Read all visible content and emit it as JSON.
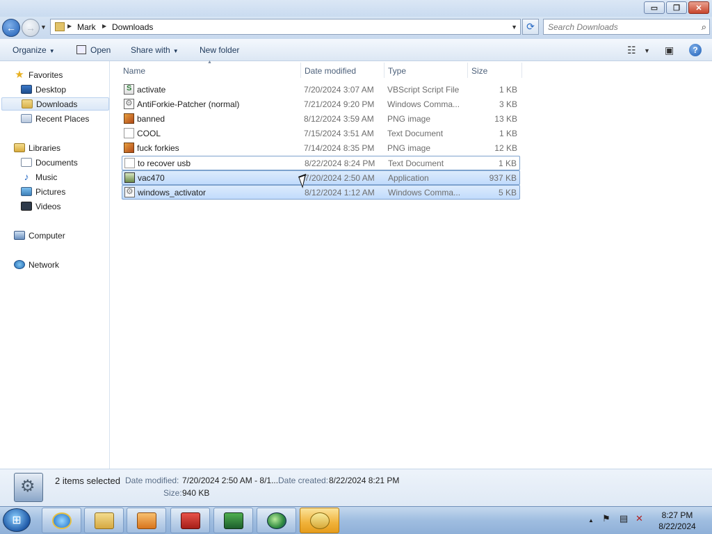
{
  "window": {
    "controls": {
      "minimize": "▭",
      "maximize": "❐",
      "close": "✕"
    }
  },
  "address": {
    "back_glyph": "←",
    "forward_glyph": "→",
    "crumbs": [
      "Mark",
      "Downloads"
    ],
    "search_placeholder": "Search Downloads"
  },
  "commands": {
    "organize": "Organize",
    "open": "Open",
    "share_with": "Share with",
    "new_folder": "New folder"
  },
  "columns": {
    "name": "Name",
    "date": "Date modified",
    "type": "Type",
    "size": "Size"
  },
  "nav": {
    "favorites": "Favorites",
    "desktop": "Desktop",
    "downloads": "Downloads",
    "recent": "Recent Places",
    "libraries": "Libraries",
    "documents": "Documents",
    "music": "Music",
    "pictures": "Pictures",
    "videos": "Videos",
    "computer": "Computer",
    "network": "Network"
  },
  "files": [
    {
      "name": "activate",
      "date": "7/20/2024 3:07 AM",
      "type": "VBScript Script File",
      "size": "1 KB",
      "icon": "vbs-icon"
    },
    {
      "name": "AntiForkie-Patcher (normal)",
      "date": "7/21/2024 9:20 PM",
      "type": "Windows Comma...",
      "size": "3 KB",
      "icon": "cmd-icon"
    },
    {
      "name": "banned",
      "date": "8/12/2024 3:59 AM",
      "type": "PNG image",
      "size": "13 KB",
      "icon": "png-icon"
    },
    {
      "name": "COOL",
      "date": "7/15/2024 3:51 AM",
      "type": "Text Document",
      "size": "1 KB",
      "icon": "txt-icon"
    },
    {
      "name": "fuck forkies",
      "date": "7/14/2024 8:35 PM",
      "type": "PNG image",
      "size": "12 KB",
      "icon": "png-icon"
    },
    {
      "name": "to recover usb",
      "date": "8/22/2024 8:24 PM",
      "type": "Text Document",
      "size": "1 KB",
      "icon": "txt-icon"
    },
    {
      "name": "vac470",
      "date": "7/20/2024 2:50 AM",
      "type": "Application",
      "size": "937 KB",
      "icon": "app-icon"
    },
    {
      "name": "windows_activator",
      "date": "8/12/2024 1:12 AM",
      "type": "Windows Comma...",
      "size": "5 KB",
      "icon": "cmd-icon"
    }
  ],
  "details": {
    "selected": "2 items selected",
    "date_modified_label": "Date modified:",
    "date_modified_value": "7/20/2024 2:50 AM - 8/1...",
    "date_created_label": "Date created:",
    "date_created_value": "8/22/2024 8:21 PM",
    "size_label": "Size:",
    "size_value": "940 KB"
  },
  "taskbar": {
    "time": "8:27 PM",
    "date": "8/22/2024",
    "tray_arrow": "▲",
    "tray_flag": "⚑"
  }
}
